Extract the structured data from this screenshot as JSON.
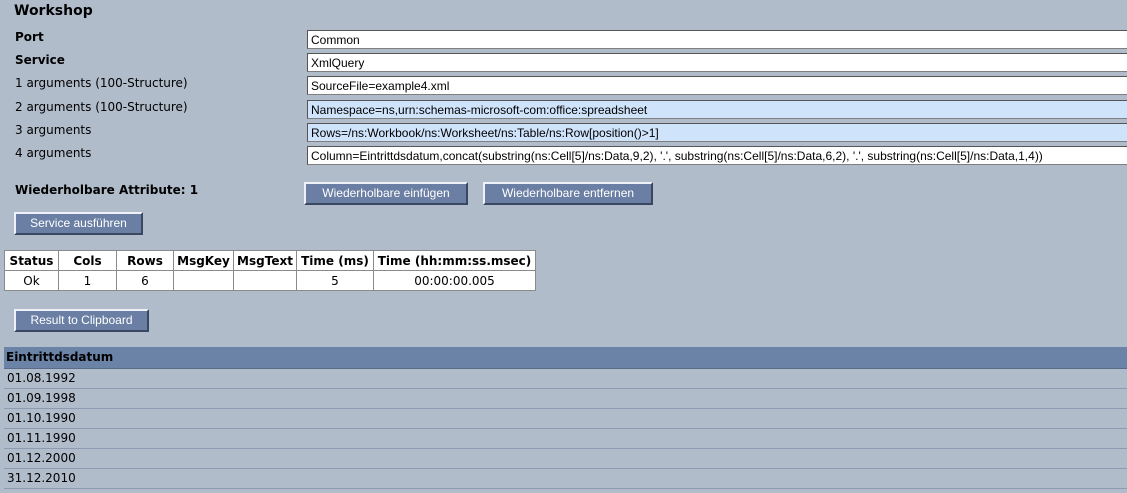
{
  "page": {
    "title": "Workshop"
  },
  "form": {
    "port": {
      "label": "Port",
      "value": "Common"
    },
    "service": {
      "label": "Service",
      "value": "XmlQuery"
    },
    "args": [
      {
        "label": "1 arguments (100-Structure)",
        "value": "SourceFile=example4.xml"
      },
      {
        "label": "2 arguments (100-Structure)",
        "value": "Namespace=ns,urn:schemas-microsoft-com:office:spreadsheet"
      },
      {
        "label": "3 arguments",
        "value": "Rows=/ns:Workbook/ns:Worksheet/ns:Table/ns:Row[position()>1]"
      },
      {
        "label": "4 arguments",
        "value": "Column=Eintrittdsdatum,concat(substring(ns:Cell[5]/ns:Data,9,2), '.', substring(ns:Cell[5]/ns:Data,6,2), '.', substring(ns:Cell[5]/ns:Data,1,4))"
      }
    ],
    "repeatable_label": "Wiederholbare Attribute: 1",
    "insert_button": "Wiederholbare einfügen",
    "remove_button": "Wiederholbare entfernen",
    "run_button": "Service ausführen"
  },
  "status_table": {
    "headers": [
      "Status",
      "Cols",
      "Rows",
      "MsgKey",
      "MsgText",
      "Time (ms)",
      "Time (hh:mm:ss.msec)"
    ],
    "row": [
      "Ok",
      "1",
      "6",
      "",
      "",
      "5",
      "00:00:00.005"
    ]
  },
  "clipboard_button": "Result to Clipboard",
  "result": {
    "column": "Eintrittdsdatum",
    "rows": [
      "01.08.1992",
      "01.09.1998",
      "01.10.1990",
      "01.11.1990",
      "01.12.2000",
      "31.12.2010"
    ]
  }
}
